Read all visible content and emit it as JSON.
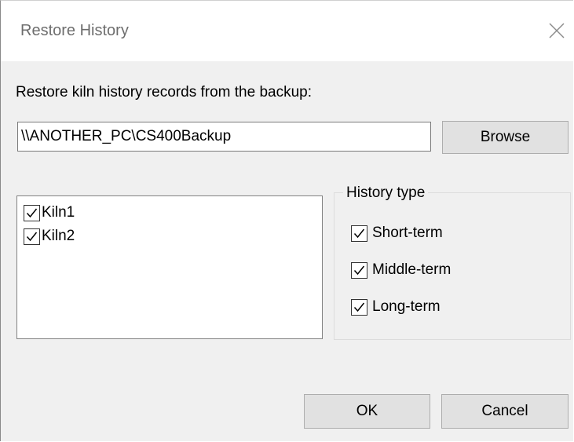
{
  "dialog": {
    "title": "Restore History",
    "close_icon": "close-icon"
  },
  "backup": {
    "prompt": "Restore kiln history records from the backup:",
    "path_value": "\\\\ANOTHER_PC\\CS400Backup",
    "browse_label": "Browse"
  },
  "kilns": {
    "items": [
      {
        "label": "Kiln1",
        "checked": true
      },
      {
        "label": "Kiln2",
        "checked": true
      }
    ]
  },
  "history_type": {
    "legend": "History type",
    "options": [
      {
        "label": "Short-term",
        "checked": true
      },
      {
        "label": "Middle-term",
        "checked": true
      },
      {
        "label": "Long-term",
        "checked": true
      }
    ]
  },
  "footer": {
    "ok_label": "OK",
    "cancel_label": "Cancel"
  },
  "icons": {
    "checkbox_mark": "check-icon"
  }
}
